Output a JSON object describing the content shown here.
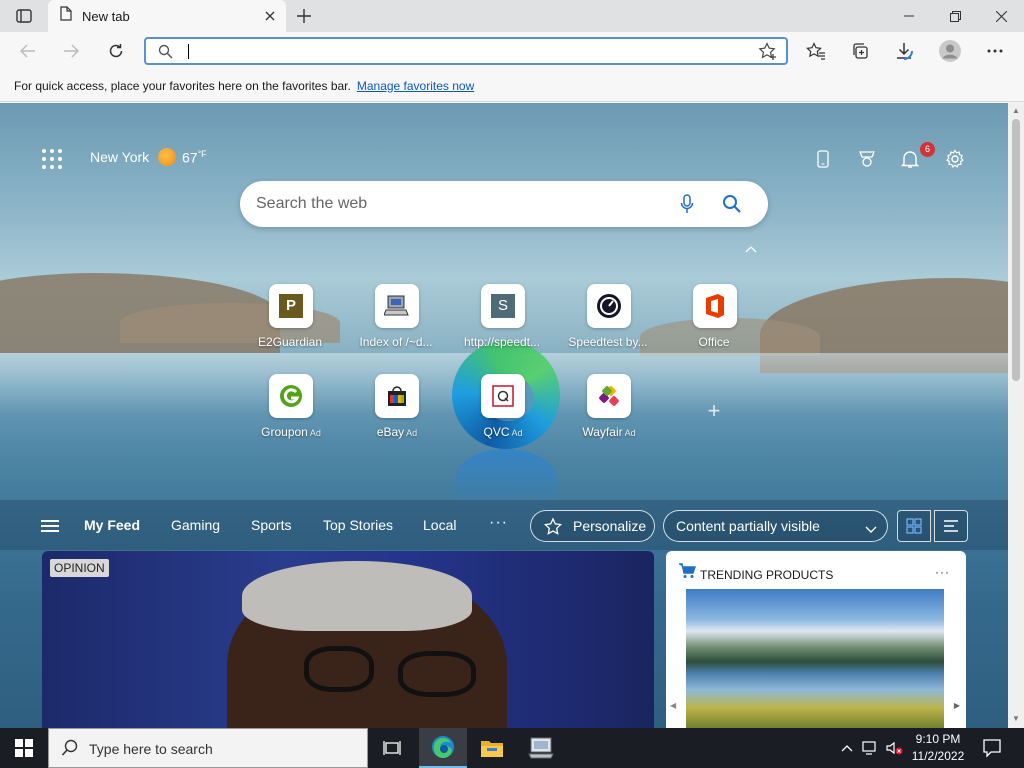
{
  "browser": {
    "tab_title": "New tab",
    "address_value": "",
    "favorites_bar_text": "For quick access, place your favorites here on the favorites bar.",
    "favorites_bar_link": "Manage favorites now"
  },
  "newtab": {
    "weather": {
      "city": "New York",
      "temp": "67",
      "unit": "°F"
    },
    "notifications_count": "6",
    "search_placeholder": "Search the web",
    "quick_links": [
      {
        "label": "E2Guardian",
        "ad": "",
        "icon": "letter-p-icon"
      },
      {
        "label": "Index of /~d...",
        "ad": "",
        "icon": "computer-icon"
      },
      {
        "label": "http://speedt...",
        "ad": "",
        "icon": "letter-s-icon"
      },
      {
        "label": "Speedtest by...",
        "ad": "",
        "icon": "speedometer-icon"
      },
      {
        "label": "Office",
        "ad": "",
        "icon": "office-icon"
      },
      {
        "label": "Groupon",
        "ad": "Ad",
        "icon": "groupon-icon"
      },
      {
        "label": "eBay",
        "ad": "Ad",
        "icon": "ebay-bag-icon"
      },
      {
        "label": "QVC",
        "ad": "Ad",
        "icon": "qvc-icon"
      },
      {
        "label": "Wayfair",
        "ad": "Ad",
        "icon": "wayfair-icon"
      }
    ]
  },
  "feed": {
    "tabs": [
      "My Feed",
      "Gaming",
      "Sports",
      "Top Stories",
      "Local"
    ],
    "more": "···",
    "personalize": "Personalize",
    "content_visibility": "Content partially visible",
    "main_card_badge": "OPINION",
    "trending_title": "TRENDING PRODUCTS",
    "trending_more": "···"
  },
  "taskbar": {
    "search_placeholder": "Type here to search",
    "time": "9:10 PM",
    "date": "11/2/2022"
  },
  "colors": {
    "accent": "#0b57c5",
    "notification_badge": "#d13438",
    "taskbar": "#1a1d24"
  }
}
